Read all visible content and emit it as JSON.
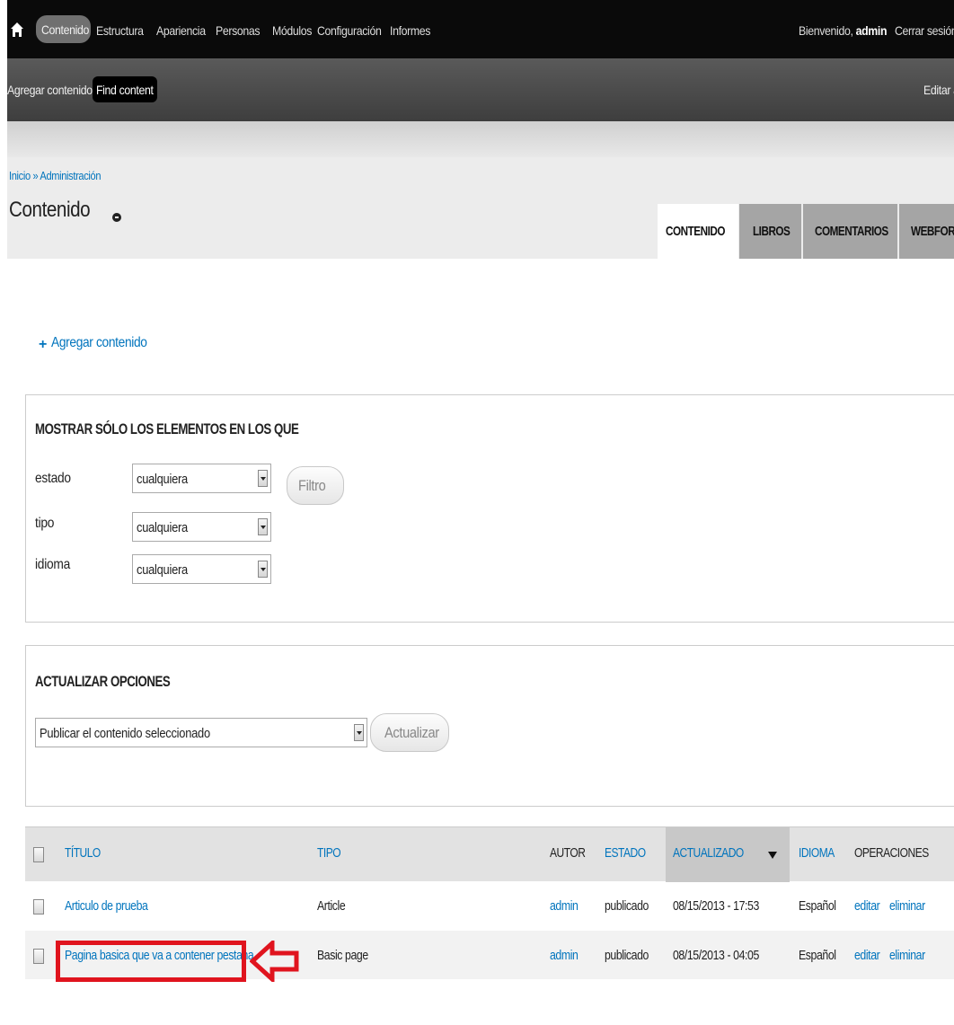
{
  "toolbar": {
    "items": [
      "Contenido",
      "Estructura",
      "Apariencia",
      "Personas",
      "Módulos",
      "Configuración",
      "Informes"
    ],
    "welcome_prefix": "Bienvenido,",
    "welcome_user": "admin",
    "logout": "Cerrar sesión"
  },
  "shortcuts": {
    "add_content": "Agregar contenido",
    "find_content": "Find content",
    "edit": "Editar a"
  },
  "breadcrumb": "Inicio » Administración",
  "page_title": "Contenido",
  "tabs": [
    "CONTENIDO",
    "LIBROS",
    "COMENTARIOS",
    "WEBFORM"
  ],
  "add_content_link": "Agregar contenido",
  "filter": {
    "title": "MOSTRAR SÓLO LOS ELEMENTOS EN LOS QUE",
    "fields": [
      {
        "label": "estado",
        "value": "cualquiera"
      },
      {
        "label": "tipo",
        "value": "cualquiera"
      },
      {
        "label": "idioma",
        "value": "cualquiera"
      }
    ],
    "button": "Filtro"
  },
  "update": {
    "title": "ACTUALIZAR OPCIONES",
    "selected": "Publicar el contenido seleccionado",
    "button": "Actualizar"
  },
  "table": {
    "headers": {
      "title": "TÍTULO",
      "type": "TIPO",
      "author": "AUTOR",
      "status": "ESTADO",
      "updated": "ACTUALIZADO",
      "language": "IDIOMA",
      "operations": "OPERACIONES"
    },
    "rows": [
      {
        "title": "Articulo de prueba",
        "type": "Article",
        "author": "admin",
        "status": "publicado",
        "updated": "08/15/2013 - 17:53",
        "language": "Español",
        "edit": "editar",
        "delete": "eliminar"
      },
      {
        "title": "Pagina basica que va a contener pestana",
        "type": "Basic page",
        "author": "admin",
        "status": "publicado",
        "updated": "08/15/2013 - 04:05",
        "language": "Español",
        "edit": "editar",
        "delete": "eliminar"
      }
    ]
  },
  "colors": {
    "link": "#0074bd",
    "annotation": "#e0141e"
  }
}
